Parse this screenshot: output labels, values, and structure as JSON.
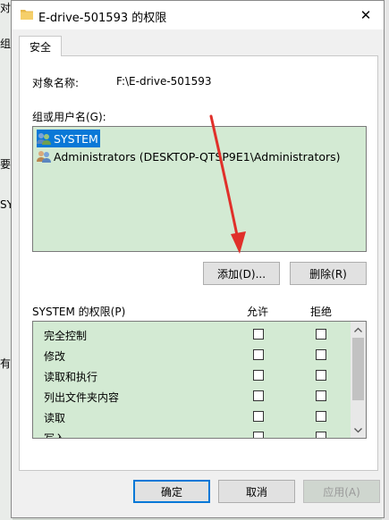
{
  "background": {
    "left_fragments": [
      "对",
      "组",
      "要",
      "SY",
      "有"
    ]
  },
  "window": {
    "title": "E-drive-501593 的权限",
    "close_glyph": "✕"
  },
  "tab": {
    "label": "安全"
  },
  "object": {
    "label": "对象名称:",
    "value": "F:\\E-drive-501593"
  },
  "groups": {
    "label": "组或用户名(G):",
    "items": [
      {
        "name": "SYSTEM",
        "selected": true
      },
      {
        "name": "Administrators (DESKTOP-QTSP9E1\\Administrators)",
        "selected": false
      }
    ]
  },
  "buttons": {
    "add": "添加(D)...",
    "remove": "删除(R)",
    "ok": "确定",
    "cancel": "取消",
    "apply": "应用(A)"
  },
  "permissions": {
    "header": "SYSTEM 的权限(P)",
    "allow_label": "允许",
    "deny_label": "拒绝",
    "items": [
      {
        "name": "完全控制",
        "allow": false,
        "deny": false
      },
      {
        "name": "修改",
        "allow": false,
        "deny": false
      },
      {
        "name": "读取和执行",
        "allow": false,
        "deny": false
      },
      {
        "name": "列出文件夹内容",
        "allow": false,
        "deny": false
      },
      {
        "name": "读取",
        "allow": false,
        "deny": false
      },
      {
        "name": "写入",
        "allow": false,
        "deny": false
      }
    ]
  },
  "colors": {
    "accent": "#0078d7",
    "list_background": "#d3ead3",
    "annotation_arrow": "#e0302a"
  }
}
